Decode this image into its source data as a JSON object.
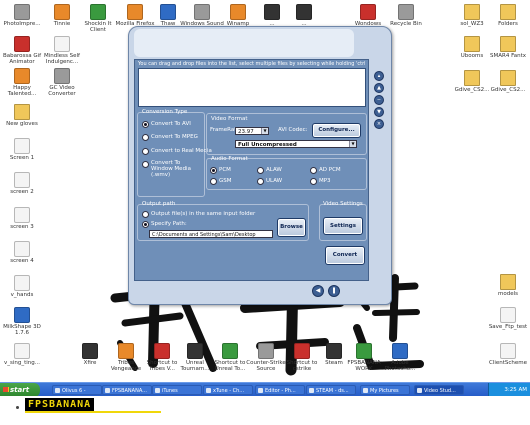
{
  "desktop": {
    "icons": [
      {
        "label": "PhotoImpre...",
        "icon": "app-icon",
        "kind": "grey"
      },
      {
        "label": "Babarossa Gif Animator",
        "icon": "app-icon",
        "kind": "red"
      },
      {
        "label": "Happy Talented...",
        "icon": "app-icon",
        "kind": "orange"
      },
      {
        "label": "New gloves",
        "icon": "folder-icon",
        "kind": "fold"
      },
      {
        "label": "Screen 1",
        "icon": "image-file-icon",
        "kind": "doc"
      },
      {
        "label": "screen 2",
        "icon": "image-file-icon",
        "kind": "doc"
      },
      {
        "label": "screen 3",
        "icon": "image-file-icon",
        "kind": "doc"
      },
      {
        "label": "screen 4",
        "icon": "image-file-icon",
        "kind": "doc"
      },
      {
        "label": "v_hands",
        "icon": "file-icon",
        "kind": "doc"
      },
      {
        "label": "MilkShape 3D 1.7.6",
        "icon": "app-icon",
        "kind": "blue"
      },
      {
        "label": "v_sing_ting...",
        "icon": "file-icon",
        "kind": "doc"
      },
      {
        "label": "Tinnie",
        "icon": "app-icon",
        "kind": "orange"
      },
      {
        "label": "Mindless Self Indulgenc...",
        "icon": "file-icon",
        "kind": "doc"
      },
      {
        "label": "GC Video Converter",
        "icon": "app-icon",
        "kind": "grey"
      },
      {
        "label": "Shockin It Client",
        "icon": "app-icon",
        "kind": "green"
      },
      {
        "label": "Mozilla Firefox",
        "icon": "firefox-icon",
        "kind": "orange"
      },
      {
        "label": "Thaw",
        "icon": "app-icon",
        "kind": "blue"
      },
      {
        "label": "Windows Sound Recorder",
        "icon": "app-icon",
        "kind": "grey"
      },
      {
        "label": "Winamp",
        "icon": "app-icon",
        "kind": "orange"
      },
      {
        "label": "...",
        "icon": "app-icon",
        "kind": "dark"
      },
      {
        "label": "...",
        "icon": "app-icon",
        "kind": "dark"
      },
      {
        "label": "Wondows",
        "icon": "app-icon",
        "kind": "red"
      },
      {
        "label": "Recycle Bin",
        "icon": "recycle-bin-icon",
        "kind": "grey"
      },
      {
        "label": "sol_WZ3",
        "icon": "folder-icon",
        "kind": "fold"
      },
      {
        "label": "Folders",
        "icon": "folder-icon",
        "kind": "fold"
      },
      {
        "label": "Ubooms",
        "icon": "folder-icon",
        "kind": "fold"
      },
      {
        "label": "SMAR4 Fantx",
        "icon": "folder-icon",
        "kind": "fold"
      },
      {
        "label": "Gdive_CS2...",
        "icon": "folder-icon",
        "kind": "fold"
      },
      {
        "label": "Gdive_CS2...",
        "icon": "folder-icon",
        "kind": "fold"
      },
      {
        "label": "models",
        "icon": "folder-icon",
        "kind": "fold"
      },
      {
        "label": "Save_Ftp_test",
        "icon": "file-icon",
        "kind": "doc"
      },
      {
        "label": "ClientScheme",
        "icon": "file-icon",
        "kind": "doc"
      },
      {
        "label": "Xfire",
        "icon": "app-icon",
        "kind": "dark"
      },
      {
        "label": "Tribes Vengeance",
        "icon": "app-icon",
        "kind": "orange"
      },
      {
        "label": "Shortcut to Tribes V...",
        "icon": "app-icon",
        "kind": "red"
      },
      {
        "label": "Unreal Tournam...",
        "icon": "app-icon",
        "kind": "dark"
      },
      {
        "label": "Shortcut to Unreal To...",
        "icon": "app-icon",
        "kind": "green"
      },
      {
        "label": "Counter-Strike Source",
        "icon": "app-icon",
        "kind": "grey"
      },
      {
        "label": "Shortcut to cstrike",
        "icon": "app-icon",
        "kind": "red"
      },
      {
        "label": "Steam",
        "icon": "steam-icon",
        "kind": "dark"
      },
      {
        "label": "FPSBANANA WORK",
        "icon": "app-icon",
        "kind": "green"
      },
      {
        "label": "Adobe Photosho...",
        "icon": "app-icon",
        "kind": "blue"
      }
    ]
  },
  "app": {
    "hint": "You can drag and drop files into the list, select multiple files by selecting while holding 'ctrl' key.",
    "conversion_type": {
      "title": "Conversion Type",
      "options": [
        "Convert To AVI",
        "Convert To MPEG",
        "Convert to Real Media",
        "Convert To Window Media (.wmv)"
      ],
      "selected": 0
    },
    "video_format": {
      "title": "Video Format",
      "framerate_label": "FrameRate:",
      "framerate_value": "23.97",
      "codec_label": "AVI Codec:",
      "configure_label": "Configure...",
      "codec_value": "Full Uncompressed"
    },
    "audio_format": {
      "title": "Audio Format",
      "options": [
        "PCM",
        "ALAW",
        "AD PCM",
        "GSM",
        "ULAW",
        "MP3"
      ],
      "selected": 0
    },
    "output_path": {
      "title": "Output path",
      "option_input": "Output file(s) in the same input folder",
      "option_specify": "Specify Path:",
      "path_value": "C:\\Documents and Settings\\Sam\\Desktop",
      "browse_label": "Browse"
    },
    "video_settings": {
      "title": "Video Settings",
      "settings_label": "Settings"
    },
    "convert_label": "Convert"
  },
  "taskbar": {
    "start_label": "start",
    "tasks": [
      "Olivus 6 -",
      "FPSBANANA...",
      "iTunes",
      "xTune - Ch...",
      "Editor - Ph...",
      "STEAM - ds...",
      "My Pictures",
      "Video Stud..."
    ],
    "active_index": 7,
    "clock": "3:25 AM"
  },
  "banner": {
    "text": "FPSBANANA"
  },
  "colors": {
    "app_panel": "#6f8fb8",
    "taskbar": "#245ac7",
    "banner_yellow": "#f0d70a"
  }
}
